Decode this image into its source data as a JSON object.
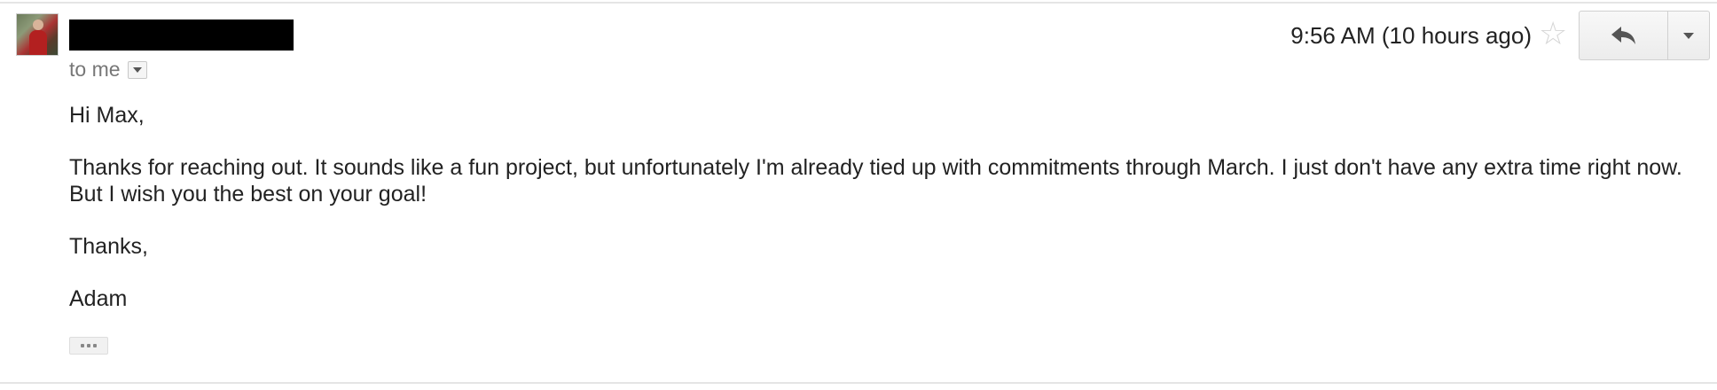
{
  "message": {
    "recipient_line": "to me",
    "timestamp": "9:56 AM (10 hours ago)",
    "icons": {
      "recipient_dropdown": "chevron-down-icon",
      "star": "star-icon",
      "reply": "reply-icon",
      "more": "chevron-down-icon",
      "trimmed": "ellipsis-icon"
    },
    "body": {
      "greeting": "Hi Max,",
      "paragraph": "Thanks for reaching out. It sounds like a fun project, but unfortunately I'm already tied up with commitments through March. I just don't have any extra time right now. But I wish you the best on your goal!",
      "closing": "Thanks,",
      "signature": "Adam"
    }
  }
}
